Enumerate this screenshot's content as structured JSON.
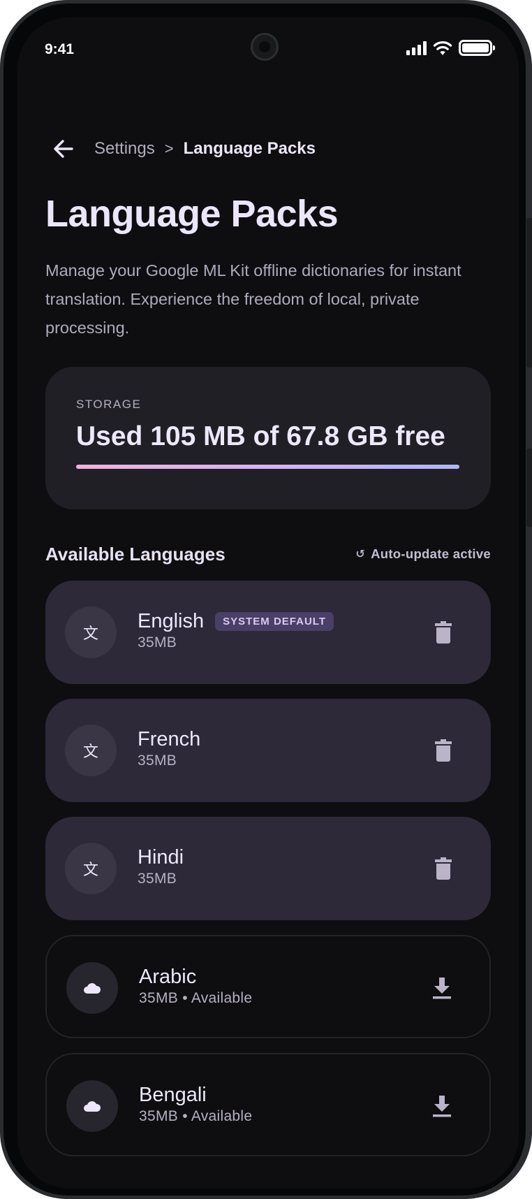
{
  "status_bar": {
    "time": "9:41"
  },
  "header": {
    "breadcrumb_parent": "Settings",
    "breadcrumb_separator": ">",
    "breadcrumb_current": "Language Packs"
  },
  "page": {
    "title": "Language Packs",
    "description": "Manage your Google ML Kit offline dictionaries for instant translation. Experience the freedom of local, private processing."
  },
  "storage": {
    "label": "STORAGE",
    "value": "Used 105 MB of 67.8 GB free"
  },
  "section": {
    "title": "Available Languages",
    "auto_update_icon": "↺",
    "auto_update": "Auto-update active"
  },
  "languages": [
    {
      "name": "English",
      "badge": "SYSTEM DEFAULT",
      "size": "35MB",
      "icon": "translate-icon",
      "glyph": "文",
      "action": "delete-icon",
      "state": "installed"
    },
    {
      "name": "French",
      "size": "35MB",
      "icon": "translate-icon",
      "glyph": "文",
      "action": "delete-icon",
      "state": "installed"
    },
    {
      "name": "Hindi",
      "size": "35MB",
      "icon": "translate-icon",
      "glyph": "文",
      "action": "delete-icon",
      "state": "installed"
    },
    {
      "name": "Arabic",
      "size": "35MB • Available",
      "icon": "cloud-icon",
      "glyph": "☁️",
      "action": "download-icon",
      "state": "available"
    },
    {
      "name": "Bengali",
      "size": "35MB • Available",
      "icon": "cloud-icon",
      "glyph": "☁️",
      "action": "download-icon",
      "state": "available"
    }
  ],
  "colors": {
    "background": "#0e0e10",
    "installed_card": "#2d2939",
    "available_card_border": "#232229",
    "storage_card": "#211f26",
    "badge_bg": "#4a3f65",
    "badge_text": "#d8c9f8",
    "storage_gradient": [
      "#f0b3dd",
      "#d3b2f6",
      "#a9b8f4"
    ]
  }
}
